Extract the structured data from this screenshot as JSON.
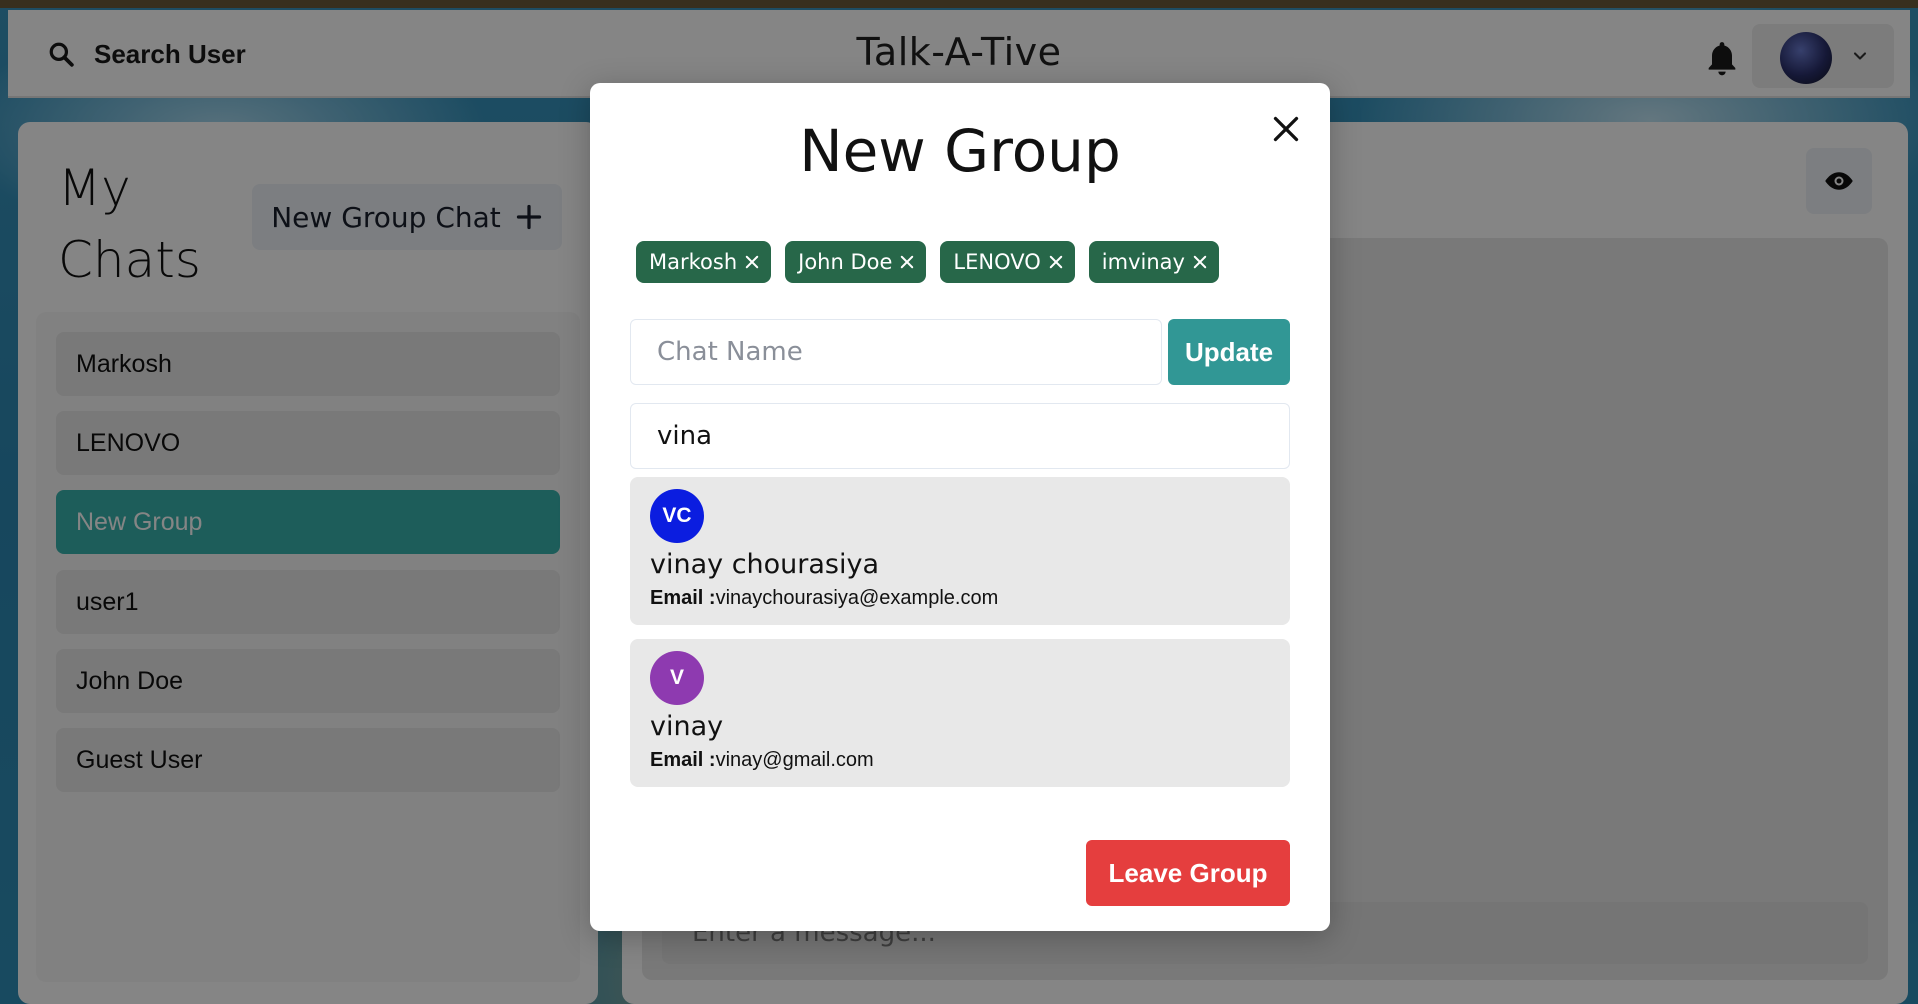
{
  "topbar": {
    "search_label": "Search User",
    "app_title": "Talk-A-Tive"
  },
  "sidebar": {
    "title": "My Chats",
    "new_group_label": "New Group Chat",
    "chats": [
      {
        "name": "Markosh",
        "active": false
      },
      {
        "name": "LENOVO",
        "active": false
      },
      {
        "name": "New Group",
        "active": true
      },
      {
        "name": "user1",
        "active": false
      },
      {
        "name": "John Doe",
        "active": false
      },
      {
        "name": "Guest User",
        "active": false
      }
    ]
  },
  "chat_window": {
    "message_placeholder": "Enter a message..."
  },
  "modal": {
    "title": "New Group",
    "members": [
      "Markosh",
      "John Doe",
      "LENOVO",
      "imvinay"
    ],
    "chat_name_placeholder": "Chat Name",
    "update_label": "Update",
    "search_value": "vina",
    "results": [
      {
        "initials": "VC",
        "name": "vinay chourasiya",
        "email_label": "Email :",
        "email": "vinaychourasiya@example.com",
        "avatar_color": "#0b1de0"
      },
      {
        "initials": "V",
        "name": "vinay",
        "email_label": "Email :",
        "email": "vinay@gmail.com",
        "avatar_color": "#8e3ab0"
      }
    ],
    "leave_label": "Leave Group"
  },
  "colors": {
    "accent_teal": "#38b2ac",
    "update_teal": "#319795",
    "badge_green": "#276749",
    "danger_red": "#e53e3e"
  }
}
